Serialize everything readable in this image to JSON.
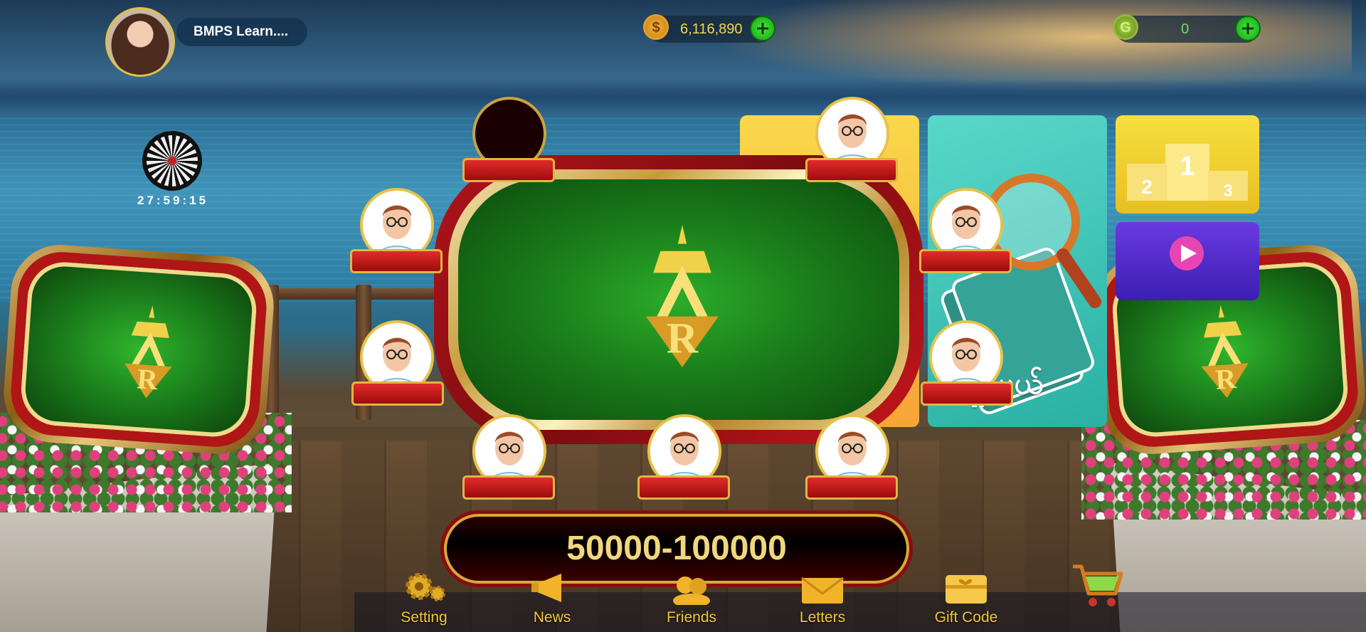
{
  "player": {
    "name": "BMPS Learn...."
  },
  "currency": {
    "coins": "6,116,890",
    "coin_symbol": "$",
    "gems": "0",
    "gem_symbol": "G"
  },
  "event": {
    "timer": "27:59:15"
  },
  "table": {
    "stakes": "50000-100000"
  },
  "side_card": {
    "text": "ရှာမယ်"
  },
  "podium": {
    "first": "1",
    "second": "2",
    "third": "3"
  },
  "nav": {
    "items": [
      {
        "label": "Setting",
        "icon": "gear-icon"
      },
      {
        "label": "News",
        "icon": "megaphone-icon"
      },
      {
        "label": "Friends",
        "icon": "friends-icon"
      },
      {
        "label": "Letters",
        "icon": "envelope-icon"
      },
      {
        "label": "Gift Code",
        "icon": "gift-card-icon"
      }
    ],
    "shop_icon": "shopping-cart-icon"
  },
  "colors": {
    "accent_gold": "#f2c93a",
    "felt_green": "#1a7d1a",
    "table_red": "#b0141b"
  }
}
